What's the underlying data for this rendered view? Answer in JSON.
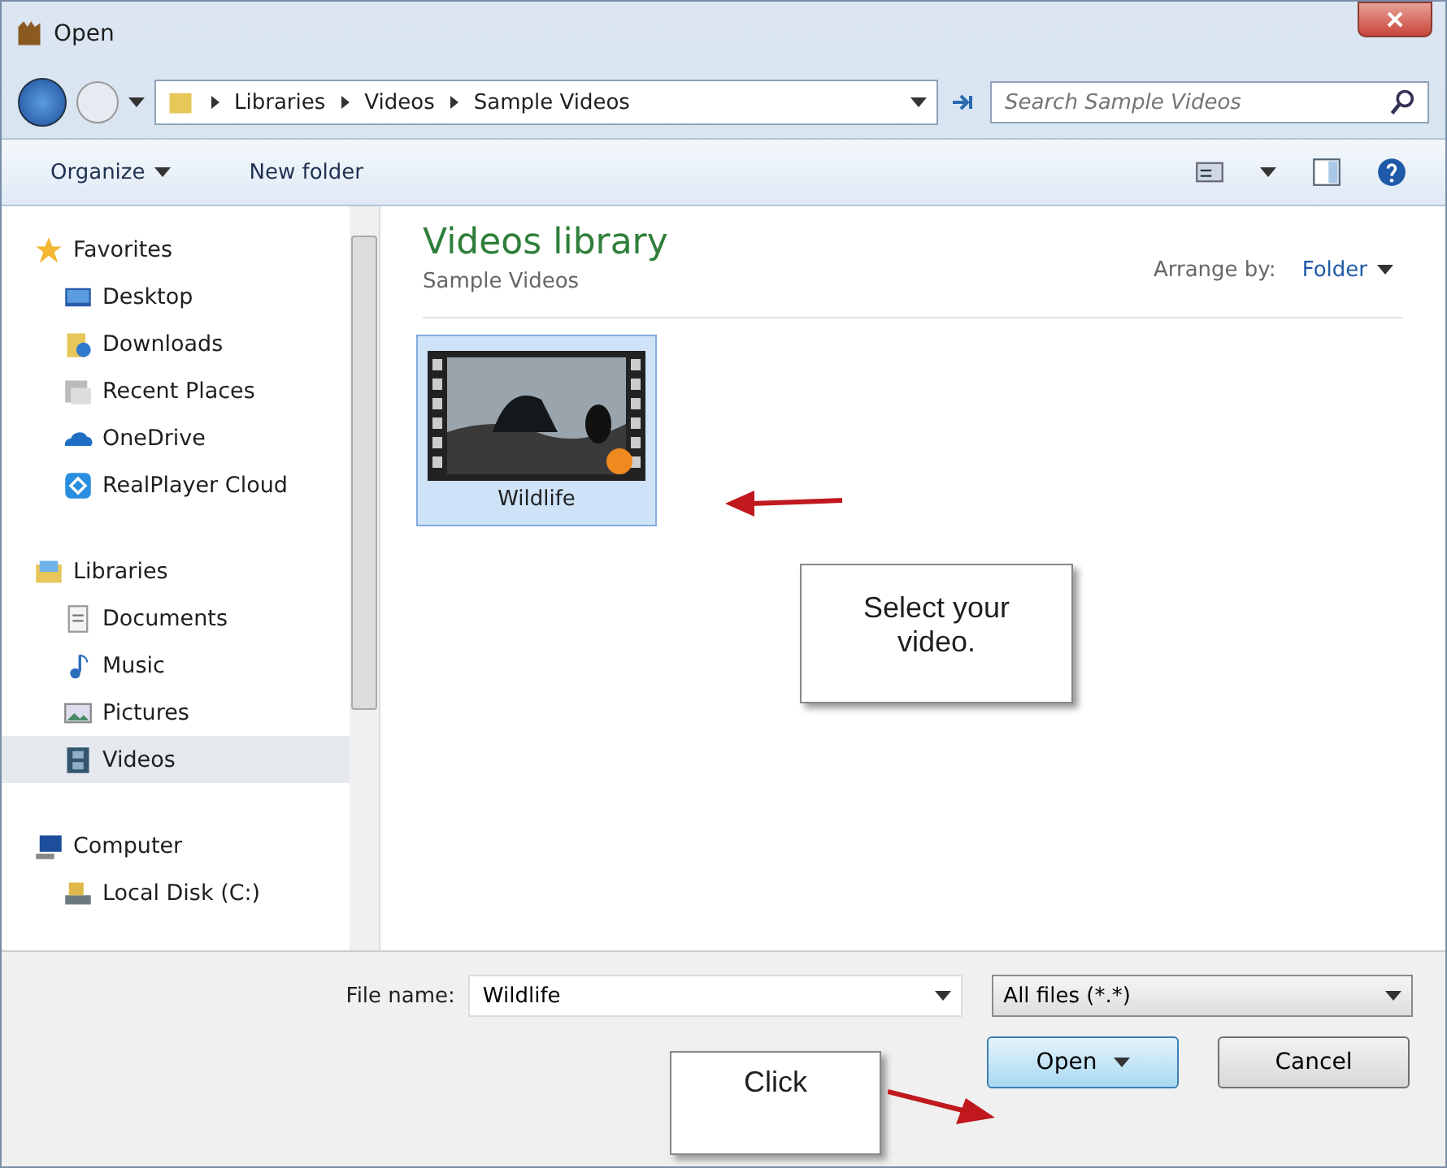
{
  "window": {
    "title": "Open"
  },
  "address": {
    "breadcrumbs": [
      "Libraries",
      "Videos",
      "Sample Videos"
    ]
  },
  "search": {
    "placeholder": "Search Sample Videos"
  },
  "toolbar": {
    "organize": "Organize",
    "new_folder": "New folder"
  },
  "sidebar": {
    "groups": [
      {
        "label": "Favorites",
        "kind": "star",
        "items": [
          {
            "label": "Desktop",
            "kind": "desktop",
            "selected": false
          },
          {
            "label": "Downloads",
            "kind": "downloads",
            "selected": false
          },
          {
            "label": "Recent Places",
            "kind": "recent",
            "selected": false
          },
          {
            "label": "OneDrive",
            "kind": "cloud",
            "selected": false
          },
          {
            "label": "RealPlayer Cloud",
            "kind": "realplayer",
            "selected": false
          }
        ]
      },
      {
        "label": "Libraries",
        "kind": "libraries",
        "items": [
          {
            "label": "Documents",
            "kind": "document",
            "selected": false
          },
          {
            "label": "Music",
            "kind": "music",
            "selected": false
          },
          {
            "label": "Pictures",
            "kind": "pictures",
            "selected": false
          },
          {
            "label": "Videos",
            "kind": "videos",
            "selected": true
          }
        ]
      },
      {
        "label": "Computer",
        "kind": "computer",
        "items": [
          {
            "label": "Local Disk (C:)",
            "kind": "disk",
            "selected": false
          }
        ]
      }
    ]
  },
  "library": {
    "title": "Videos library",
    "subtitle": "Sample Videos",
    "arrange_label": "Arrange by:",
    "arrange_value": "Folder"
  },
  "files": [
    {
      "name": "Wildlife",
      "selected": true
    }
  ],
  "callouts": [
    {
      "text": "Select your video."
    },
    {
      "text": "Click"
    }
  ],
  "file_name": {
    "label": "File name:",
    "value": "Wildlife"
  },
  "file_type": {
    "value": "All files (*.*)"
  },
  "buttons": [
    {
      "label": "Open",
      "kind": "split"
    },
    {
      "label": "Cancel",
      "kind": "plain"
    }
  ]
}
